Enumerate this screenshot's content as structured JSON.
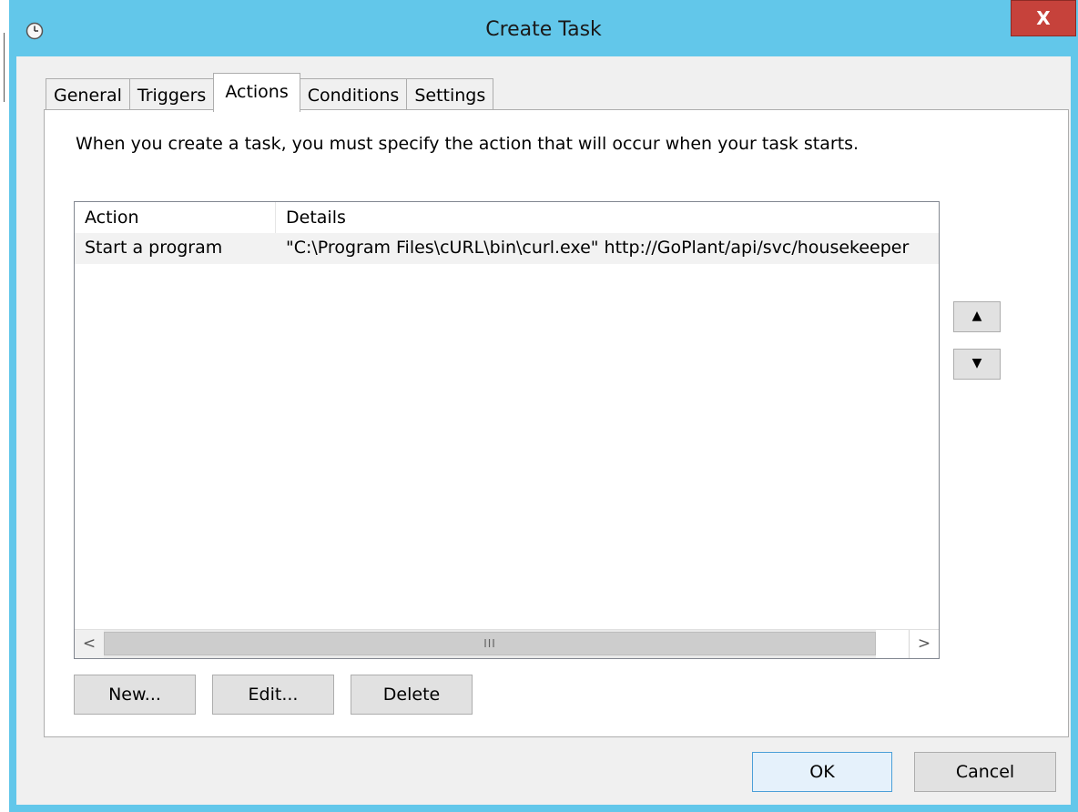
{
  "window": {
    "title": "Create Task",
    "close_label": "X",
    "icon": "clock-icon"
  },
  "tabs": [
    {
      "label": "General",
      "active": false
    },
    {
      "label": "Triggers",
      "active": false
    },
    {
      "label": "Actions",
      "active": true
    },
    {
      "label": "Conditions",
      "active": false
    },
    {
      "label": "Settings",
      "active": false
    }
  ],
  "actions_tab": {
    "instruction": "When you create a task, you must specify the action that will occur when your task starts.",
    "columns": [
      "Action",
      "Details"
    ],
    "rows": [
      {
        "action": "Start a program",
        "details": "\"C:\\Program Files\\cURL\\bin\\curl.exe\" http://GoPlant/api/svc/housekeeper"
      }
    ],
    "scrollbar": {
      "left_arrow": "<",
      "right_arrow": ">",
      "thumb_grip": "III"
    },
    "buttons": {
      "new": "New...",
      "edit": "Edit...",
      "delete": "Delete",
      "move_up": "▲",
      "move_down": "▼"
    }
  },
  "dialog_buttons": {
    "ok": "OK",
    "cancel": "Cancel"
  },
  "colors": {
    "titlebar": "#62c7ea",
    "close_button": "#c6423b",
    "client_background": "#f0f0f0",
    "selected_row": "#f2f2f2"
  }
}
